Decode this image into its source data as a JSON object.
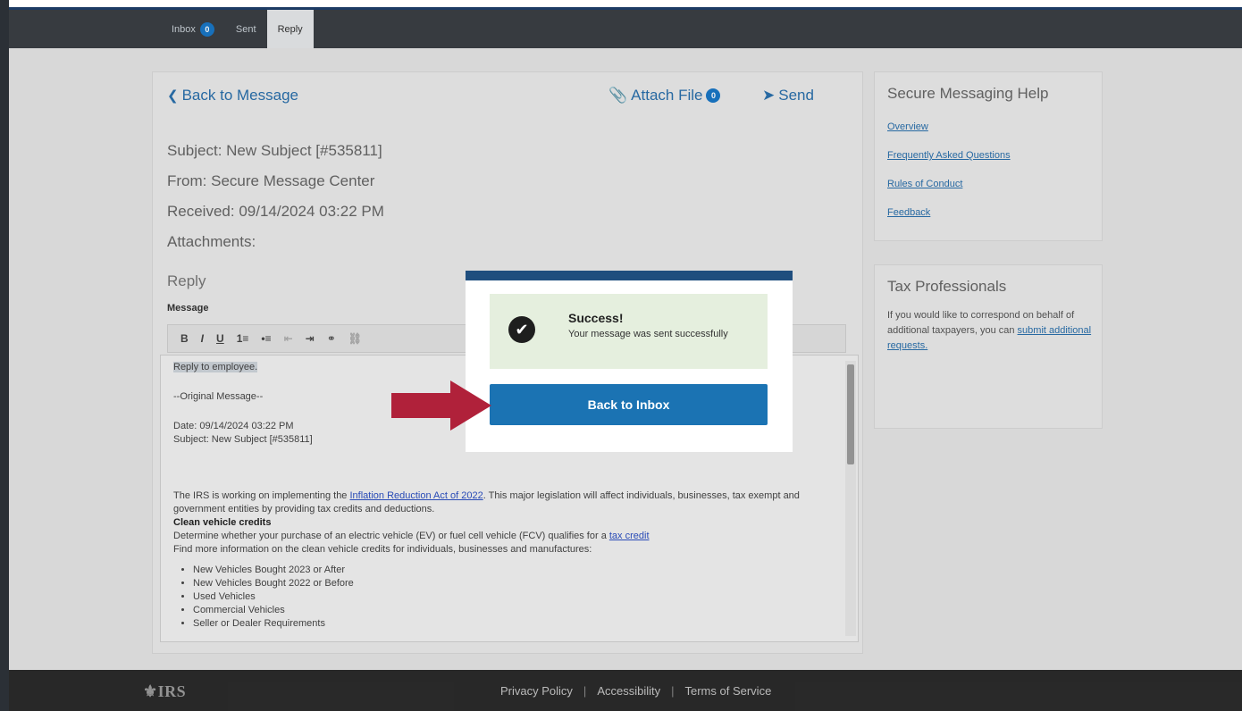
{
  "nav": {
    "tabs": [
      {
        "label": "Inbox",
        "badge": "0"
      },
      {
        "label": "Sent"
      },
      {
        "label": "Reply"
      }
    ]
  },
  "message": {
    "back_label": "Back to Message",
    "attach_label": "Attach File",
    "attach_count": "0",
    "send_label": "Send",
    "subject": "Subject: New Subject [#535811]",
    "from": "From: Secure Message Center",
    "received": "Received: 09/14/2024 03:22 PM",
    "attachments": "Attachments:",
    "reply_heading": "Reply",
    "message_label": "Message"
  },
  "toolbar": {
    "bold": "B",
    "italic": "I",
    "underline": "U",
    "ordered_list": "1≡",
    "bullet_list": "•≡",
    "outdent": "⇤",
    "indent": "⇥",
    "link": "⚭",
    "unlink": "⛓"
  },
  "editor": {
    "line1": "Reply to employee.",
    "line2": "--Original Message--",
    "line3": "Date: 09/14/2024 03:22 PM",
    "line4": "Subject: New Subject [#535811]",
    "para1_pre": "The IRS is working on implementing the ",
    "para1_link": "Inflation Reduction Act of 2022",
    "para1_post": ". This major legislation will affect individuals, businesses, tax exempt and government entities by providing tax credits and deductions.",
    "heading": "Clean vehicle credits",
    "para2_pre": "Determine whether your purchase of an electric vehicle (EV) or fuel cell vehicle (FCV) qualifies for a ",
    "para2_link": "tax credit",
    "para3": "Find more information on the clean vehicle credits for individuals, businesses and manufactures:",
    "bullets": [
      "New Vehicles Bought 2023 or After",
      "New Vehicles Bought 2022 or Before",
      "Used Vehicles",
      "Commercial Vehicles",
      "Seller or Dealer Requirements"
    ]
  },
  "help": {
    "title": "Secure Messaging Help",
    "links": [
      "Overview",
      "Frequently Asked Questions",
      "Rules of Conduct",
      "Feedback"
    ]
  },
  "tax_pros": {
    "title": "Tax Professionals",
    "text": "If you would like to correspond on behalf of additional taxpayers, you can ",
    "link": "submit additional requests."
  },
  "footer": {
    "logo": "IRS",
    "links": [
      "Privacy Policy",
      "Accessibility",
      "Terms of Service"
    ],
    "separator": "|"
  },
  "modal": {
    "title": "Success!",
    "message": "Your message was sent successfully",
    "button": "Back to Inbox"
  },
  "colors": {
    "primary": "#1b73b3",
    "link": "#2a6fab",
    "success_bg": "#e5efde",
    "arrow": "#b0213a",
    "modal_header": "#1f4e7e"
  }
}
